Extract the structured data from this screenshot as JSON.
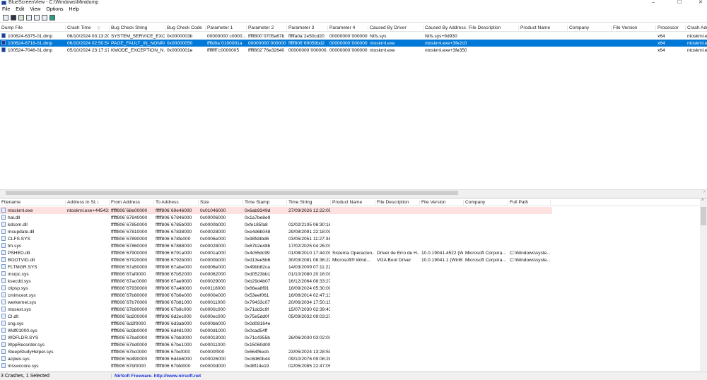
{
  "window": {
    "title": "BlueScreenView  -  C:\\Windows\\Minidump",
    "minimize": "–",
    "maximize": "☐",
    "close": "✕"
  },
  "menu": [
    "File",
    "Edit",
    "View",
    "Options",
    "Help"
  ],
  "toolbar": [
    "properties-icon",
    "save-icon",
    "reload-icon",
    "copy-icon",
    "html-report-icon",
    "find-icon",
    "exit-icon"
  ],
  "crashes": {
    "columns": [
      "Dump File",
      "Crash Time",
      "Bug Check String",
      "Bug Check Code",
      "Parameter 1",
      "Parameter 2",
      "Parameter 3",
      "Parameter 4",
      "Caused By Driver",
      "Caused By Address",
      "File Description",
      "Product Name",
      "Company",
      "File Version",
      "Processor",
      "Crash Address"
    ],
    "sort_indicator": "▽",
    "rows": [
      [
        "100624-6375-01.dmp",
        "06/10/2024 03:13:20",
        "SYSTEM_SERVICE_EXCEP...",
        "0x0000003b",
        "00000000`c0000...",
        "fffff800`0705a67b",
        "fffffa0a`2e50cd20",
        "00000000`000000...",
        "Ntfs.sys",
        "Ntfs.sys+9d930",
        "",
        "",
        "",
        "",
        "x64",
        "ntoskrnl.exe"
      ],
      [
        "100624-6718-01.dmp",
        "06/10/2024 02:50:54",
        "PAGE_FAULT_IN_NONPA...",
        "0x00000050",
        "ffffd0a`0100001a",
        "00000000`000000...",
        "fffff806`69059bd2",
        "00000000`000000...",
        "ntoskrnl.exe",
        "ntoskrnl.exe+3fe2c0",
        "",
        "",
        "",
        "",
        "x64",
        "ntoskrnl.exe"
      ],
      [
        "100524-7046-01.dmp",
        "05/10/2024 23:17:17",
        "KMODE_EXCEPTION_N...",
        "0x0000001e",
        "ffffffff`c0000005",
        "fffff802`76e32640",
        "00000000`000000...",
        "00000000`000000...",
        "ntoskrnl.exe",
        "ntoskrnl.exe+3fe350",
        "",
        "",
        "",
        "",
        "x64",
        "ntoskrnl.exe"
      ]
    ],
    "selected_index": 1
  },
  "drivers": {
    "columns": [
      "Filename",
      "Address In St...",
      "From Address",
      "To Address",
      "Size",
      "Time Stamp",
      "Time String",
      "Product Name",
      "File Description",
      "File Version",
      "Company",
      "Full Path"
    ],
    "sort_indicator": "/",
    "rows": [
      [
        "ntoskrnl.exe",
        "ntoskrnl.exe+445431",
        "fffff806`68e00000",
        "fffff806`69e46000",
        "0x01046000",
        "0x6ab9349d",
        "27/09/2026 12:22:05",
        "",
        "",
        "",
        "",
        ""
      ],
      [
        "hal.dll",
        "",
        "fffff806`67840000",
        "fffff806`67846000",
        "0x00006000",
        "0x1a7be8e9",
        "",
        "",
        "",
        "",
        "",
        ""
      ],
      [
        "kdcom.dll",
        "",
        "fffff806`67850000",
        "fffff806`6785b000",
        "0x0000b000",
        "0xfe185fa8",
        "02/02/2105 06:30:16",
        "",
        "",
        "",
        "",
        ""
      ],
      [
        "mcupdate.dll",
        "",
        "fffff806`67810000",
        "fffff806`67838000",
        "0x00028000",
        "0xe4d6b048",
        "29/08/2091 22:18:00",
        "",
        "",
        "",
        "",
        ""
      ],
      [
        "CLFS.SYS",
        "",
        "fffff806`67890000",
        "fffff806`678fe000",
        "0x0006e000",
        "0x98fd4bd6",
        "03/05/2051 11:27:34",
        "",
        "",
        "",
        "",
        ""
      ],
      [
        "tm.sys",
        "",
        "fffff806`67860000",
        "fffff806`67888000",
        "0x00028000",
        "0x67b2e48b",
        "17/02/2025 04:26:03",
        "",
        "",
        "",
        "",
        ""
      ],
      [
        "PSHED.dll",
        "",
        "fffff806`67900000",
        "fffff806`6791a000",
        "0x0001a000",
        "0x4c55dc99",
        "01/08/2010 17:44:09",
        "Sistema Operacion...",
        "Driver de Erro de H...",
        "10.0.19041.4522 (W...",
        "Microsoft Corpora...",
        "C:\\Windows\\syste..."
      ],
      [
        "BOOTVID.dll",
        "",
        "fffff806`67920000",
        "fffff806`6792b000",
        "0x0000b000",
        "0xd13ee5b6",
        "30/03/2081 08:36:22",
        "Microsoft® Wind...",
        "VGA Boot Driver",
        "10.0.19041.1 (WinB...",
        "Microsoft Corpora...",
        "C:\\Windows\\syste..."
      ],
      [
        "FLTMGR.SYS",
        "",
        "fffff806`67a50000",
        "fffff806`67abe000",
        "0x0006e000",
        "0x49bb82ca",
        "14/03/2009 07:11:22",
        "",
        "",
        "",
        "",
        ""
      ],
      [
        "msrpc.sys",
        "",
        "fffff806`67af0000",
        "fffff806`67b52000",
        "0x00062000",
        "0xd0523bb1",
        "01/10/2080 20:16:01",
        "",
        "",
        "",
        "",
        ""
      ],
      [
        "ksecdd.sys",
        "",
        "fffff806`67ac0000",
        "fffff806`67ae9000",
        "0x00029000",
        "0xb29d4b07",
        "16/12/2064 08:33:27",
        "",
        "",
        "",
        "",
        ""
      ],
      [
        "clipsp.sys",
        "",
        "fffff806`67930000",
        "fffff806`67a48000",
        "0x00118000",
        "0x66ea8f91",
        "18/09/2024 05:30:09",
        "",
        "",
        "",
        "",
        ""
      ],
      [
        "cmimcext.sys",
        "",
        "fffff806`67b60000",
        "fffff806`67b6e000",
        "0x0000e000",
        "0x53eef061",
        "16/08/2014 02:47:13",
        "",
        "",
        "",
        "",
        ""
      ],
      [
        "werkernel.sys",
        "",
        "fffff806`67b70000",
        "fffff806`67b81000",
        "0x00011000",
        "0x79433c07",
        "20/06/2034 17:50:15",
        "",
        "",
        "",
        "",
        ""
      ],
      [
        "ntosext.sys",
        "",
        "fffff806`67b90000",
        "fffff806`67b9c000",
        "0x0000c000",
        "0x71dd3c9f",
        "15/07/2030 02:39:43",
        "",
        "",
        "",
        "",
        ""
      ],
      [
        "CI.dll",
        "",
        "fffff806`6d200000",
        "fffff806`6d2ec000",
        "0x000ec000",
        "0x75e5dd0f",
        "05/09/2032 09:03:27",
        "",
        "",
        "",
        "",
        ""
      ],
      [
        "cng.sys",
        "",
        "fffff806`6d2f0000",
        "fffff806`6d3ab000",
        "0x000bb000",
        "0x0d08164e",
        "",
        "",
        "",
        "",
        "",
        ""
      ],
      [
        "Wdf01000.sys",
        "",
        "fffff806`6d3b0000",
        "fffff806`6d481000",
        "0x000d1000",
        "0x0cad54ff",
        "",
        "",
        "",
        "",
        "",
        ""
      ],
      [
        "WDFLDR.SYS",
        "",
        "fffff806`67ba0000",
        "fffff806`67bb3000",
        "0x00013000",
        "0x71c4355b",
        "26/06/2030 03:02:03",
        "",
        "",
        "",
        "",
        ""
      ],
      [
        "WppRecorder.sys",
        "",
        "fffff806`67bd0000",
        "fffff806`67be1000",
        "0x00011000",
        "0x15060d00",
        "",
        "",
        "",
        "",
        "",
        ""
      ],
      [
        "SleepStudyHelper.sys",
        "",
        "fffff806`67bc0000",
        "fffff806`67bcf000",
        "0x0000f000",
        "0x664f6ecb",
        "23/05/2024 13:28:59",
        "",
        "",
        "",
        "",
        ""
      ],
      [
        "acpiex.sys",
        "",
        "fffff806`6d490000",
        "fffff806`6d4b6000",
        "0x00026000",
        "0xc8d60b44",
        "09/10/2076 09:06:28",
        "",
        "",
        "",
        "",
        ""
      ],
      [
        "msseccore.sys",
        "",
        "fffff806`67bf0000",
        "fffff806`67bfd000",
        "0x0000d000",
        "0xd8f14e19",
        "02/05/2085 22:47:05",
        "",
        "",
        "",
        "",
        ""
      ]
    ],
    "highlighted_index": 0
  },
  "status": {
    "summary": "3 Crashes, 1 Selected",
    "credit": "NirSoft Freeware.  http://www.nirsoft.net"
  },
  "colors": {
    "selection": "#0078d7",
    "highlight": "#fde1e1",
    "link": "#1a33d6"
  }
}
